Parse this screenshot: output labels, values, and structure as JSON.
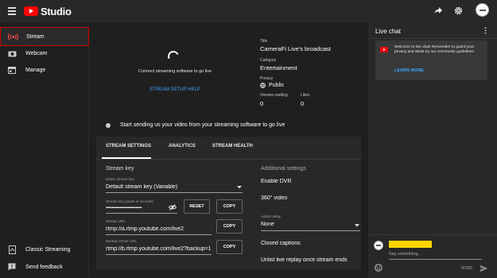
{
  "header": {
    "brand": "Studio"
  },
  "sidebar": {
    "items": [
      {
        "label": "Stream",
        "icon": "broadcast-icon",
        "active": true
      },
      {
        "label": "Webcam",
        "icon": "camera-icon"
      },
      {
        "label": "Manage",
        "icon": "calendar-icon"
      }
    ],
    "bottom": [
      {
        "label": "Classic Streaming",
        "icon": "classic-icon"
      },
      {
        "label": "Send feedback",
        "icon": "feedback-icon"
      }
    ]
  },
  "preview": {
    "message": "Connect streaming software to go live",
    "help_link": "STREAM SETUP HELP"
  },
  "info": {
    "title_label": "Title",
    "title": "CameraFi Live's broadcast",
    "category_label": "Category",
    "category": "Entertainment",
    "privacy_label": "Privacy",
    "privacy": "Public",
    "viewers_label": "Viewers waiting",
    "viewers": "0",
    "likes_label": "Likes",
    "likes": "0"
  },
  "status": {
    "text": "Start sending us your video from your streaming software to go live"
  },
  "tabs": [
    "STREAM SETTINGS",
    "ANALYTICS",
    "STREAM HEALTH"
  ],
  "stream_key": {
    "section": "Stream key",
    "select_label": "Select stream key",
    "select_value": "Default stream key (Variable)",
    "key_label": "Stream key (paste in encoder)",
    "key_value": "••••••••••••••••••••••••••••••••••••",
    "reset": "RESET",
    "copy": "COPY",
    "url_label": "Stream URL",
    "url": "rtmp://a.rtmp.youtube.com/live2",
    "backup_label": "Backup server URL",
    "backup": "rtmp://b.rtmp.youtube.com/live2?backup=1"
  },
  "additional": {
    "section": "Additional settings",
    "dvr": "Enable DVR",
    "video360": "360° video",
    "delay_label": "Added delay",
    "delay_value": "None",
    "captions": "Closed captions",
    "unlist": "Unlist live replay once stream ends"
  },
  "chat": {
    "title": "Live chat",
    "welcome": "Welcome to live chat! Remember to guard your privacy and abide by our community guidelines.",
    "learn_more": "LEARN MORE",
    "placeholder": "Say something...",
    "counter": "0/200"
  },
  "colors": {
    "accent": "#3ea6ff",
    "brand_red": "#ff0000",
    "username_highlight": "#ffd600"
  }
}
